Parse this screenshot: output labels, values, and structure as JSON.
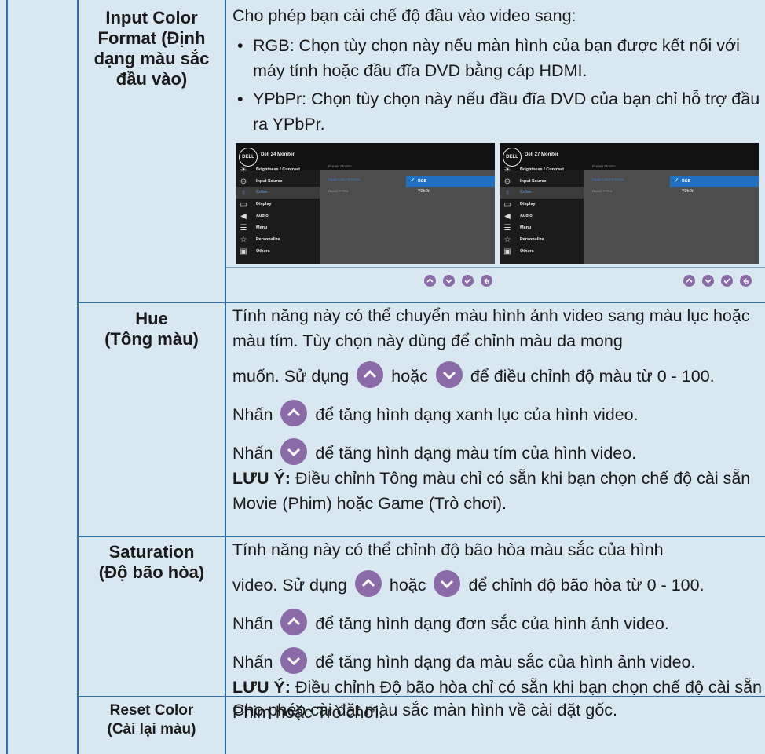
{
  "rows": [
    {
      "label": "Input Color Format (Định dạng màu sắc đầu vào)",
      "intro": "Cho phép bạn cài chế độ đầu vào video sang:",
      "bullets": [
        "RGB: Chọn tùy chọn này nếu màn hình của bạn được kết nối với máy tính hoặc đầu đĩa DVD bằng cáp HDMI.",
        "YPbPr: Chọn tùy chọn này nếu đầu đĩa DVD của bạn chỉ hỗ trợ đầu ra YPbPr."
      ]
    },
    {
      "label_line1": "Hue",
      "label_line2": "(Tông màu)",
      "p1": "Tính năng này có thể chuyển màu hình ảnh video sang màu lục hoặc màu tím. Tùy chọn này dùng để chỉnh màu da mong",
      "p2a": "muốn. Sử dụng",
      "p2b": "hoặc",
      "p2c": "để điều chỉnh độ màu từ 0 - 100.",
      "p3a": "Nhấn",
      "p3b": "để tăng hình dạng xanh lục của hình video.",
      "p4a": "Nhấn",
      "p4b": "để tăng hình dạng màu tím của hình video.",
      "note_label": "LƯU Ý:",
      "note_text": " Điều chỉnh Tông màu chỉ có sẵn khi bạn chọn chế độ cài sẵn Movie (Phim) hoặc Game (Trò chơi)."
    },
    {
      "label_line1": "Saturation",
      "label_line2": "(Độ bão hòa)",
      "p1": "Tính năng này có thể chỉnh độ bão hòa màu sắc của hình",
      "p2a": "video. Sử dụng",
      "p2b": "hoặc",
      "p2c": "để chỉnh độ bão hòa từ 0 - 100.",
      "p3a": "Nhấn",
      "p3b": "để tăng hình dạng đơn sắc của hình ảnh video.",
      "p4a": "Nhấn",
      "p4b": "để tăng hình dạng đa màu sắc của hình ảnh video.",
      "note_label": "LƯU Ý:",
      "note_text": " Điều chỉnh Độ bão hòa chỉ có sẵn khi bạn chọn chế độ cài sẵn Phim hoặc Trò chơi."
    },
    {
      "label_line1": "Reset Color",
      "label_line2": "(Cài lại màu)",
      "desc": "Cho phép cài đặt màu sắc màn hình về cài đặt gốc."
    }
  ],
  "osd": {
    "logo": "DELL",
    "models": [
      "Dell 24 Monitor",
      "Dell 27 Monitor"
    ],
    "menu": [
      "Brightness / Contrast",
      "Input Source",
      "Color",
      "Display",
      "Audio",
      "Menu",
      "Personalize",
      "Others"
    ],
    "submenu": [
      "Preset Modes",
      "Input Color Format",
      "Reset Color"
    ],
    "options": [
      "RGB",
      "YPbPr"
    ]
  },
  "colors": {
    "background": "#d9e7f1",
    "rule": "#2f6fa3",
    "button": "#8a6ba7",
    "highlight": "#2b7fd4"
  }
}
